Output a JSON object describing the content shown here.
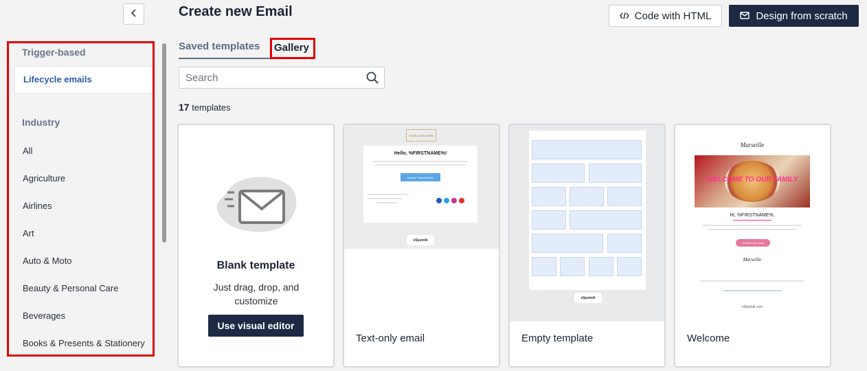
{
  "header": {
    "title": "Create new Email",
    "code_html_label": "Code with HTML",
    "design_scratch_label": "Design from scratch"
  },
  "sidebar": {
    "section_trigger": "Trigger-based",
    "active_item": "Lifecycle emails",
    "section_industry": "Industry",
    "items": [
      "All",
      "Agriculture",
      "Airlines",
      "Art",
      "Auto & Moto",
      "Beauty & Personal Care",
      "Beverages",
      "Books & Presents & Stationery"
    ]
  },
  "tabs": {
    "saved": "Saved templates",
    "gallery": "Gallery"
  },
  "search": {
    "placeholder": "Search"
  },
  "count": {
    "number": "17",
    "suffix": "templates"
  },
  "cards": {
    "blank": {
      "title": "Blank template",
      "description": "Just drag, drop, and customize",
      "button": "Use visual editor"
    },
    "text_only": {
      "label": "Text-only email",
      "logo": "YOUR LOGO HERE",
      "greeting": "Hello, %FIRSTNAME%!",
      "cta": "Update Payment Info",
      "brand": "eSputnik"
    },
    "empty": {
      "label": "Empty template",
      "brand": "eSputnik"
    },
    "welcome": {
      "label": "Welcome",
      "logo": "Marseille",
      "banner": "WELCOME TO OUR FAMILY",
      "greeting": "Hi, %FIRSTNAME%,",
      "cta": "Confirm my email",
      "brand": "eSputnik.com"
    }
  },
  "colors": {
    "accent_dark": "#1e2a44",
    "link_blue": "#2c5aa5",
    "highlight_red": "#e20000",
    "welcome_pink": "#ff2f8e"
  }
}
